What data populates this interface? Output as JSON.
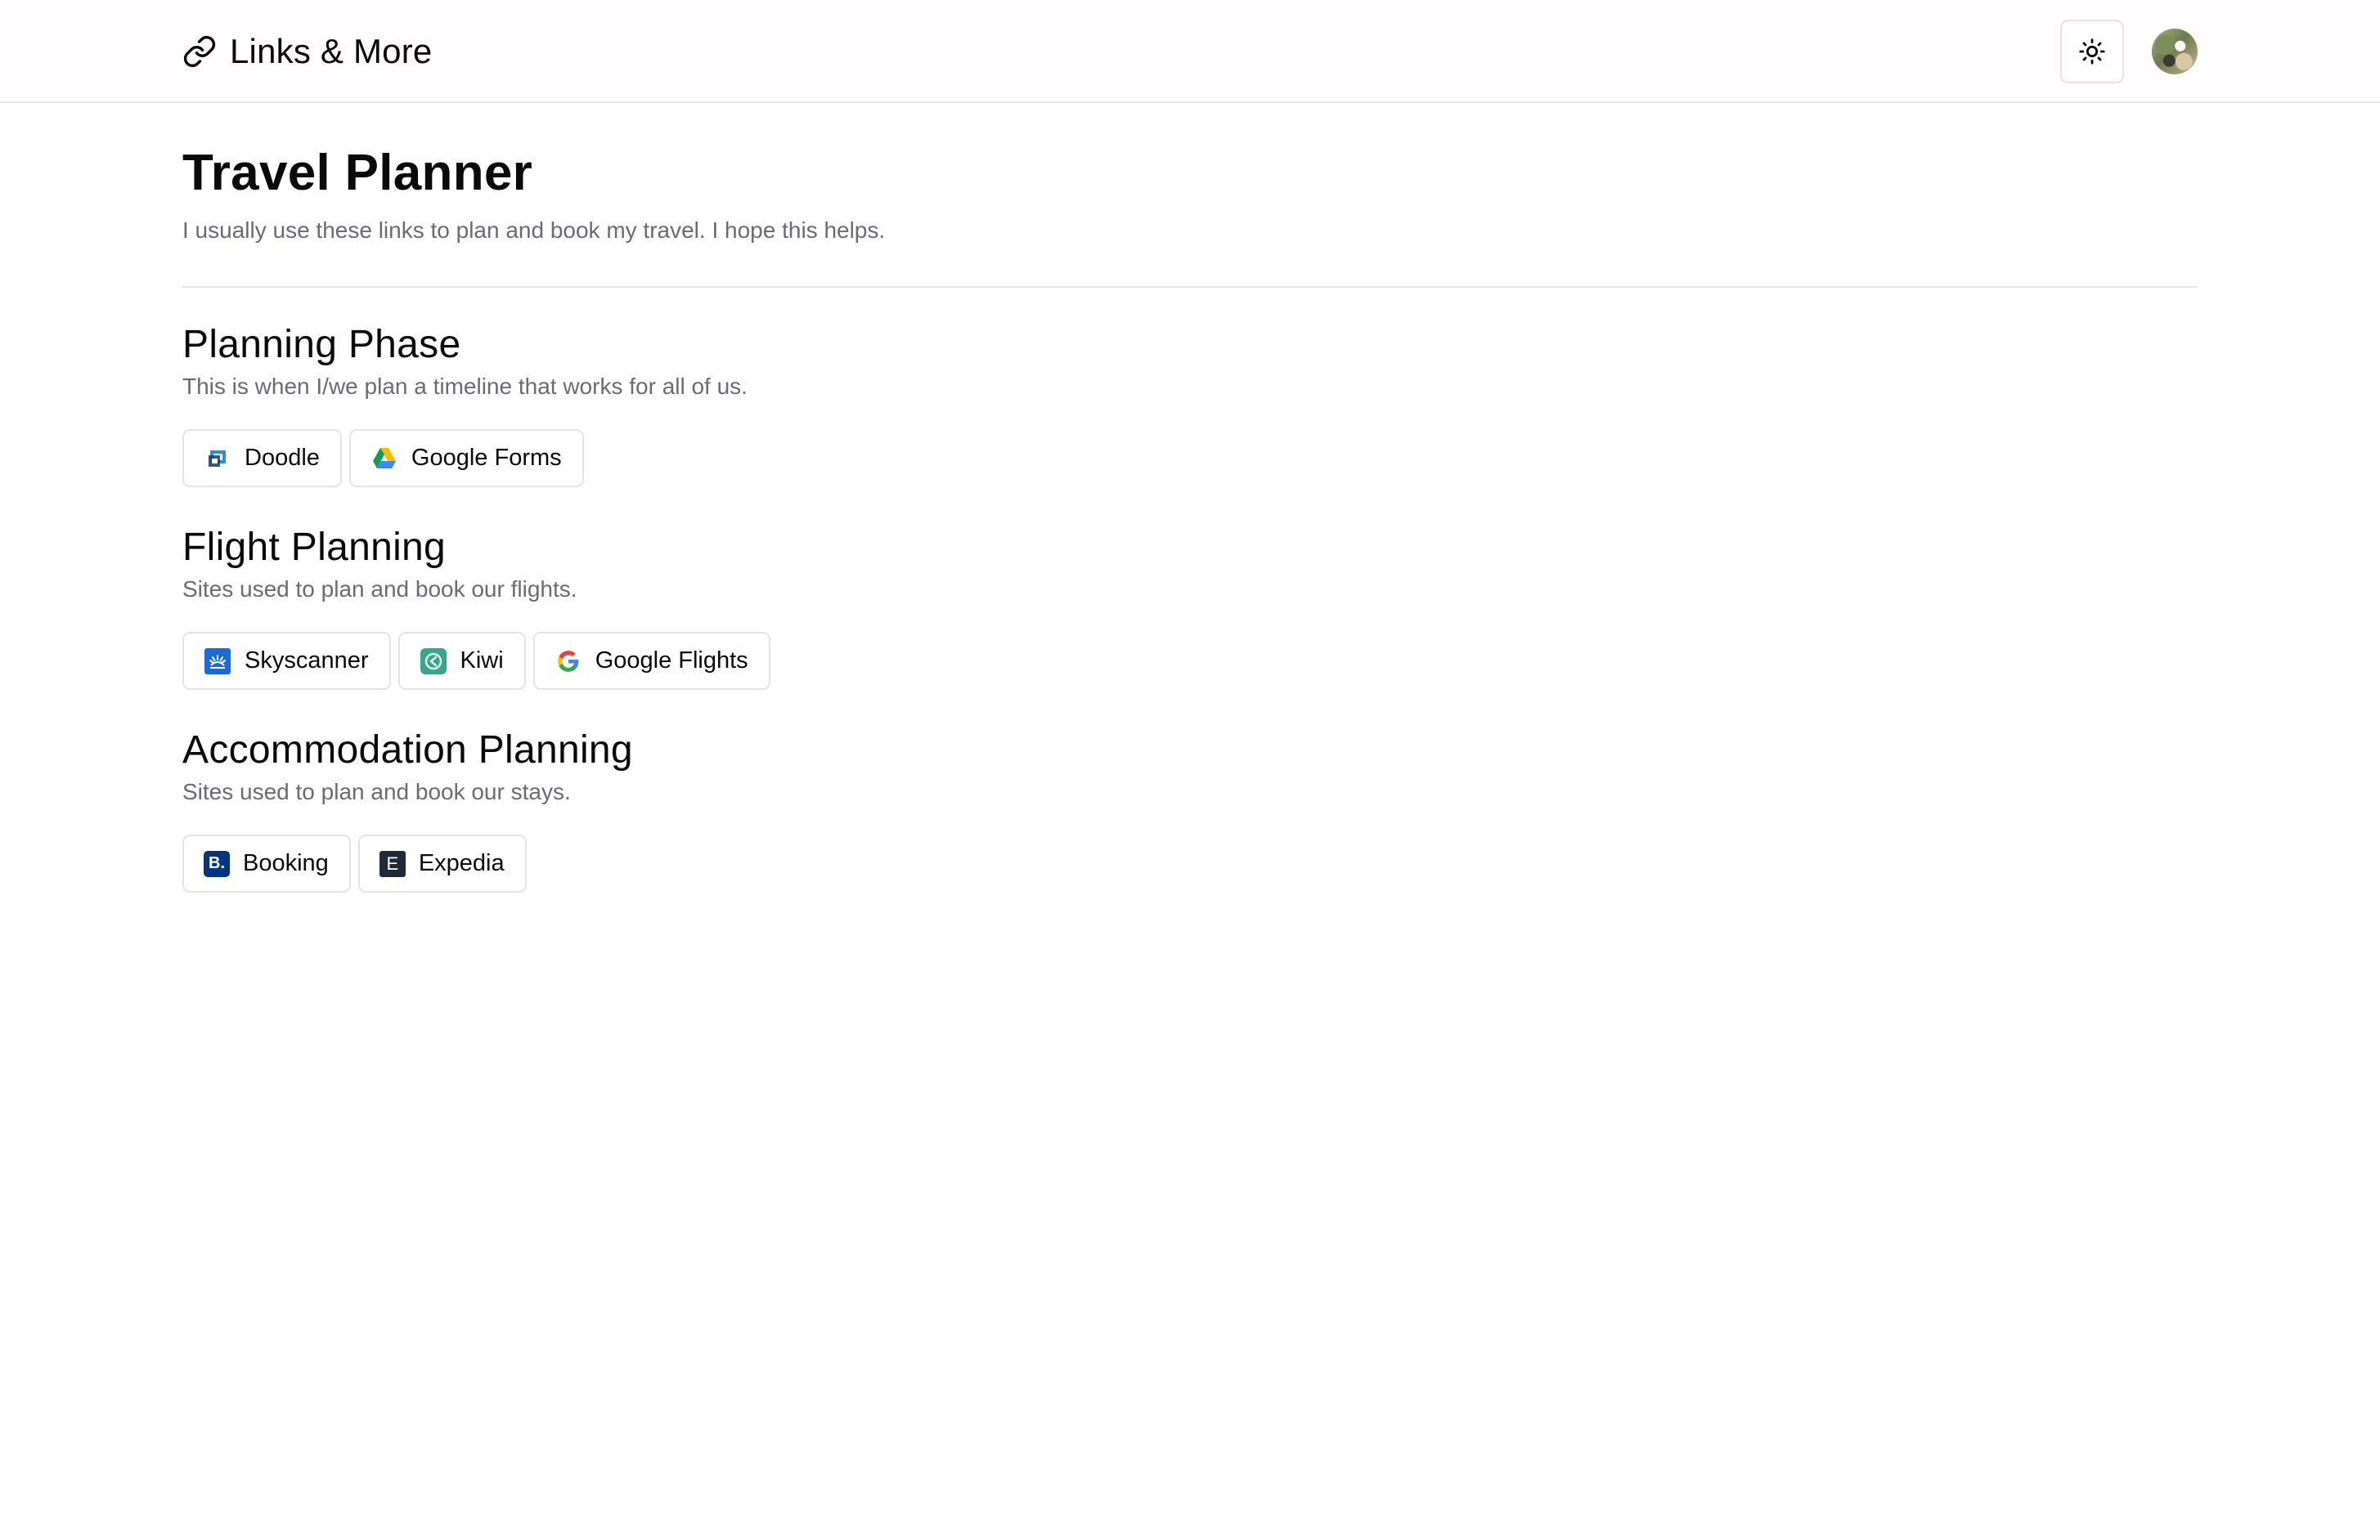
{
  "header": {
    "brand_title": "Links & More",
    "brand_icon": "link-icon",
    "theme_icon": "sun-icon",
    "avatar": "user-avatar"
  },
  "page": {
    "title": "Travel Planner",
    "description": "I usually use these links to plan and book my travel. I hope this helps."
  },
  "sections": [
    {
      "title": "Planning Phase",
      "description": "This is when I/we plan a timeline that works for all of us.",
      "links": [
        {
          "label": "Doodle",
          "icon": "doodle-icon"
        },
        {
          "label": "Google Forms",
          "icon": "google-drive-icon"
        }
      ]
    },
    {
      "title": "Flight Planning",
      "description": "Sites used to plan and book our flights.",
      "links": [
        {
          "label": "Skyscanner",
          "icon": "skyscanner-icon"
        },
        {
          "label": "Kiwi",
          "icon": "kiwi-icon"
        },
        {
          "label": "Google Flights",
          "icon": "google-icon"
        }
      ]
    },
    {
      "title": "Accommodation Planning",
      "description": "Sites used to plan and book our stays.",
      "links": [
        {
          "label": "Booking",
          "icon": "booking-icon",
          "icon_text": "B."
        },
        {
          "label": "Expedia",
          "icon": "expedia-icon",
          "icon_text": "E"
        }
      ]
    }
  ],
  "colors": {
    "text": "#0a0a0a",
    "muted": "#6b6b72",
    "border": "#e4e4e7",
    "booking": "#003580",
    "expedia": "#1f2937",
    "skyscanner": "#0062e3",
    "kiwi": "#00a991"
  }
}
